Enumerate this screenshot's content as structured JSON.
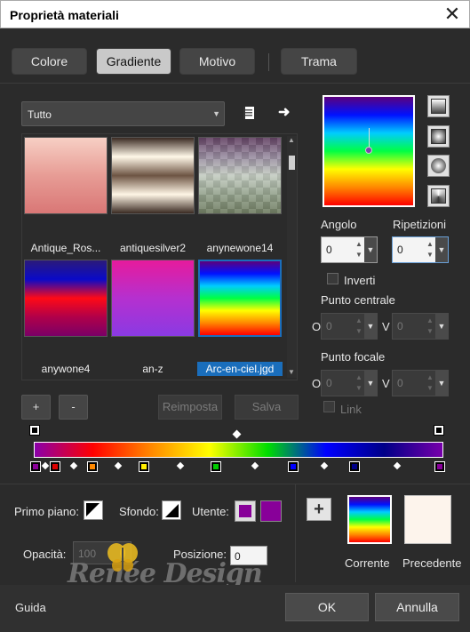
{
  "window": {
    "title": "Proprietà materiali",
    "close_icon": "close-icon"
  },
  "tabs": [
    {
      "label": "Colore",
      "active": false
    },
    {
      "label": "Gradiente",
      "active": true
    },
    {
      "label": "Motivo",
      "active": false
    },
    {
      "label": "Trama",
      "active": false
    }
  ],
  "category": {
    "selected": "Tutto"
  },
  "gradients": [
    {
      "name": "Antique_Ros...",
      "selected": false,
      "stops": [
        "#f7cfc4",
        "#e79c95",
        "#d97776"
      ]
    },
    {
      "name": "antiquesilver2",
      "selected": false,
      "stops": [
        "#3a2a22",
        "#fff8e8",
        "#6d5443",
        "#fff6e6",
        "#3a2a22"
      ]
    },
    {
      "name": "anynewone14",
      "selected": false,
      "stops": [
        "#4a1e4a",
        "#8f7f99",
        "#c8d3c5",
        "#8a9c80",
        "#5a6b48"
      ]
    },
    {
      "name": "anywone4",
      "selected": false,
      "stops": [
        "#2b1a7a",
        "#0a0ac8",
        "#ff0a16",
        "#b0004a",
        "#7a0066"
      ]
    },
    {
      "name": "an-z",
      "selected": false,
      "stops": [
        "#e61b9c",
        "#b530cf",
        "#8a3ae3"
      ]
    },
    {
      "name": "Arc-en-ciel.jgd",
      "selected": true,
      "stops": [
        "#5c007c",
        "#0011ff",
        "#00ccff",
        "#00ff44",
        "#ffff00",
        "#ff8800",
        "#ff0000"
      ]
    }
  ],
  "buttons": {
    "add": "+",
    "remove": "-",
    "reset": "Reimposta",
    "save": "Salva"
  },
  "angle": {
    "label": "Angolo",
    "value": "0"
  },
  "repeats": {
    "label": "Ripetizioni",
    "value": "0"
  },
  "invert": {
    "label": "Inverti"
  },
  "center_point": {
    "label": "Punto centrale",
    "o_label": "O",
    "v_label": "V",
    "o_value": "0",
    "v_value": "0"
  },
  "focal_point": {
    "label": "Punto focale",
    "o_label": "O",
    "v_label": "V",
    "o_value": "0",
    "v_value": "0"
  },
  "link": {
    "label": "Link"
  },
  "gradient_bar": {
    "colors": [
      "#8a00aa",
      "#ff0000",
      "#ff8800",
      "#ffff00",
      "#00dd00",
      "#0000ff",
      "#000088",
      "#7700aa"
    ],
    "stop_colors": [
      "#8a0099",
      "#dd0000",
      "#ff8800",
      "#ffee00",
      "#00cc00",
      "#0000ff",
      "#000088",
      "#880099"
    ]
  },
  "bottom": {
    "foreground_label": "Primo piano:",
    "background_label": "Sfondo:",
    "user_label": "Utente:",
    "user_color": "#880099",
    "opacity_label": "Opacità:",
    "opacity_value": "100",
    "position_label": "Posizione:",
    "position_value": "0",
    "current_label": "Corrente",
    "previous_label": "Precedente",
    "previous_color": "#fdf4ec"
  },
  "watermark": "Renée Design",
  "footer": {
    "help": "Guida",
    "ok": "OK",
    "cancel": "Annulla"
  }
}
